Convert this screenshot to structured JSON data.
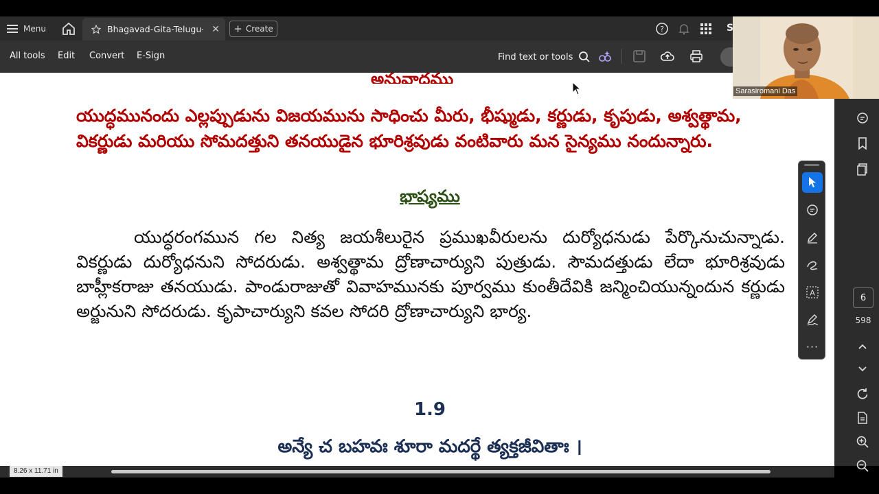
{
  "app": {
    "menu_label": "Menu",
    "tab_title": "Bhagavad-Gita-Telugu-...",
    "create_label": "Create",
    "sign_in_fragment": "S"
  },
  "toolbar": {
    "items": [
      "All tools",
      "Edit",
      "Convert",
      "E-Sign"
    ],
    "find_label": "Find text or tools"
  },
  "document": {
    "heading_top": "అనువాదము",
    "translation": "యుద్ధమునందు ఎల్లప్పుడును విజయమును సాధించు మీరు, భీష్ముడు, కర్ణుడు, కృపుడు, అశ్వత్థామ, వికర్ణుడు మరియు సోమదత్తుని తనయుడైన భూరిశ్రవుడు వంటివారు మన సైన్యము నందున్నారు.",
    "bhashyam_heading": "భాష్యము",
    "purport": "యుద్ధరంగమున గల నిత్య జయశీలురైన ప్రముఖవీరులను దుర్యోధనుడు పేర్కొనుచున్నాడు. వికర్ణుడు దుర్యోధనుని సోదరుడు. అశ్వత్థామ ద్రోణాచార్యుని పుత్రుడు. సౌమదత్తుడు లేదా భూరిశ్రవుడు బాహ్లీకరాజు తనయుడు. పాండురాజుతో వివాహమునకు పూర్వము కుంతీదేవికి జన్మించియున్నందున కర్ణుడు అర్జునుని సోదరుడు. కృపాచార్యుని కవల సోదరి ద్రోణాచార్యుని భార్య.",
    "verse_number": "1.9",
    "verse_line": "అన్యే చ బహవః శూరా మదర్థే త్యక్తజీవితాః ।"
  },
  "status": {
    "page_dimensions": "8.26 x 11.71 in",
    "current_page": "6",
    "total_pages": "598"
  },
  "webcam": {
    "participant_name": "Sarasiromani Das"
  },
  "colors": {
    "translation_red": "#b10000",
    "bhashyam_green": "#2d5016",
    "verse_navy": "#1b2f55",
    "accent_blue": "#1473e6"
  }
}
